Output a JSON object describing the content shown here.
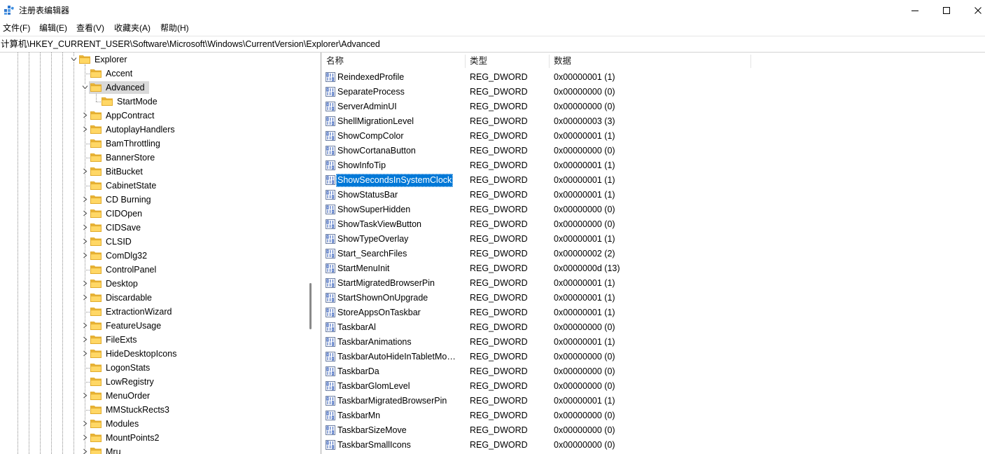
{
  "window": {
    "title": "注册表编辑器",
    "app_icon": "registry-editor-icon",
    "controls": {
      "minimize_icon": "minimize-icon",
      "maximize_icon": "maximize-icon",
      "close_icon": "close-icon"
    }
  },
  "menu": {
    "items": [
      "文件(F)",
      "编辑(E)",
      "查看(V)",
      "收藏夹(A)",
      "帮助(H)"
    ]
  },
  "address_bar": {
    "path": "计算机\\HKEY_CURRENT_USER\\Software\\Microsoft\\Windows\\CurrentVersion\\Explorer\\Advanced"
  },
  "tree": {
    "folder_icon": "folder-icon",
    "items": [
      {
        "label": "Explorer",
        "depth": 0,
        "has_children": true,
        "expanded": true
      },
      {
        "label": "Accent",
        "depth": 1,
        "has_children": false
      },
      {
        "label": "Advanced",
        "depth": 1,
        "has_children": true,
        "expanded": true,
        "selected": true
      },
      {
        "label": "StartMode",
        "depth": 2,
        "has_children": false
      },
      {
        "label": "AppContract",
        "depth": 1,
        "has_children": true
      },
      {
        "label": "AutoplayHandlers",
        "depth": 1,
        "has_children": true
      },
      {
        "label": "BamThrottling",
        "depth": 1,
        "has_children": false
      },
      {
        "label": "BannerStore",
        "depth": 1,
        "has_children": false
      },
      {
        "label": "BitBucket",
        "depth": 1,
        "has_children": true
      },
      {
        "label": "CabinetState",
        "depth": 1,
        "has_children": false
      },
      {
        "label": "CD Burning",
        "depth": 1,
        "has_children": true
      },
      {
        "label": "CIDOpen",
        "depth": 1,
        "has_children": true
      },
      {
        "label": "CIDSave",
        "depth": 1,
        "has_children": true
      },
      {
        "label": "CLSID",
        "depth": 1,
        "has_children": true
      },
      {
        "label": "ComDlg32",
        "depth": 1,
        "has_children": true
      },
      {
        "label": "ControlPanel",
        "depth": 1,
        "has_children": false
      },
      {
        "label": "Desktop",
        "depth": 1,
        "has_children": true
      },
      {
        "label": "Discardable",
        "depth": 1,
        "has_children": true
      },
      {
        "label": "ExtractionWizard",
        "depth": 1,
        "has_children": false
      },
      {
        "label": "FeatureUsage",
        "depth": 1,
        "has_children": true
      },
      {
        "label": "FileExts",
        "depth": 1,
        "has_children": true
      },
      {
        "label": "HideDesktopIcons",
        "depth": 1,
        "has_children": true
      },
      {
        "label": "LogonStats",
        "depth": 1,
        "has_children": false
      },
      {
        "label": "LowRegistry",
        "depth": 1,
        "has_children": false
      },
      {
        "label": "MenuOrder",
        "depth": 1,
        "has_children": true
      },
      {
        "label": "MMStuckRects3",
        "depth": 1,
        "has_children": false
      },
      {
        "label": "Modules",
        "depth": 1,
        "has_children": true
      },
      {
        "label": "MountPoints2",
        "depth": 1,
        "has_children": true
      },
      {
        "label": "Mru",
        "depth": 1,
        "has_children": true
      }
    ]
  },
  "list": {
    "value_icon": "reg-dword-icon",
    "columns": [
      "名称",
      "类型",
      "数据"
    ],
    "rows": [
      {
        "name": "ReindexedProfile",
        "type": "REG_DWORD",
        "data": "0x00000001 (1)"
      },
      {
        "name": "SeparateProcess",
        "type": "REG_DWORD",
        "data": "0x00000000 (0)"
      },
      {
        "name": "ServerAdminUI",
        "type": "REG_DWORD",
        "data": "0x00000000 (0)"
      },
      {
        "name": "ShellMigrationLevel",
        "type": "REG_DWORD",
        "data": "0x00000003 (3)"
      },
      {
        "name": "ShowCompColor",
        "type": "REG_DWORD",
        "data": "0x00000001 (1)"
      },
      {
        "name": "ShowCortanaButton",
        "type": "REG_DWORD",
        "data": "0x00000000 (0)"
      },
      {
        "name": "ShowInfoTip",
        "type": "REG_DWORD",
        "data": "0x00000001 (1)"
      },
      {
        "name": "ShowSecondsInSystemClock",
        "type": "REG_DWORD",
        "data": "0x00000001 (1)",
        "selected": true
      },
      {
        "name": "ShowStatusBar",
        "type": "REG_DWORD",
        "data": "0x00000001 (1)"
      },
      {
        "name": "ShowSuperHidden",
        "type": "REG_DWORD",
        "data": "0x00000000 (0)"
      },
      {
        "name": "ShowTaskViewButton",
        "type": "REG_DWORD",
        "data": "0x00000000 (0)"
      },
      {
        "name": "ShowTypeOverlay",
        "type": "REG_DWORD",
        "data": "0x00000001 (1)"
      },
      {
        "name": "Start_SearchFiles",
        "type": "REG_DWORD",
        "data": "0x00000002 (2)"
      },
      {
        "name": "StartMenuInit",
        "type": "REG_DWORD",
        "data": "0x0000000d (13)"
      },
      {
        "name": "StartMigratedBrowserPin",
        "type": "REG_DWORD",
        "data": "0x00000001 (1)"
      },
      {
        "name": "StartShownOnUpgrade",
        "type": "REG_DWORD",
        "data": "0x00000001 (1)"
      },
      {
        "name": "StoreAppsOnTaskbar",
        "type": "REG_DWORD",
        "data": "0x00000001 (1)"
      },
      {
        "name": "TaskbarAl",
        "type": "REG_DWORD",
        "data": "0x00000000 (0)"
      },
      {
        "name": "TaskbarAnimations",
        "type": "REG_DWORD",
        "data": "0x00000001 (1)"
      },
      {
        "name": "TaskbarAutoHideInTabletMo…",
        "type": "REG_DWORD",
        "data": "0x00000000 (0)"
      },
      {
        "name": "TaskbarDa",
        "type": "REG_DWORD",
        "data": "0x00000000 (0)"
      },
      {
        "name": "TaskbarGlomLevel",
        "type": "REG_DWORD",
        "data": "0x00000000 (0)"
      },
      {
        "name": "TaskbarMigratedBrowserPin",
        "type": "REG_DWORD",
        "data": "0x00000001 (1)"
      },
      {
        "name": "TaskbarMn",
        "type": "REG_DWORD",
        "data": "0x00000000 (0)"
      },
      {
        "name": "TaskbarSizeMove",
        "type": "REG_DWORD",
        "data": "0x00000000 (0)"
      },
      {
        "name": "TaskbarSmallIcons",
        "type": "REG_DWORD",
        "data": "0x00000000 (0)"
      }
    ]
  },
  "colors": {
    "selection": "#0078d7",
    "selection_text": "#ffffff",
    "tree_selection": "#d9d9d9",
    "folder": "#ffd765",
    "folder_edge": "#e2ab2b",
    "value_icon": "#2a56b8"
  }
}
